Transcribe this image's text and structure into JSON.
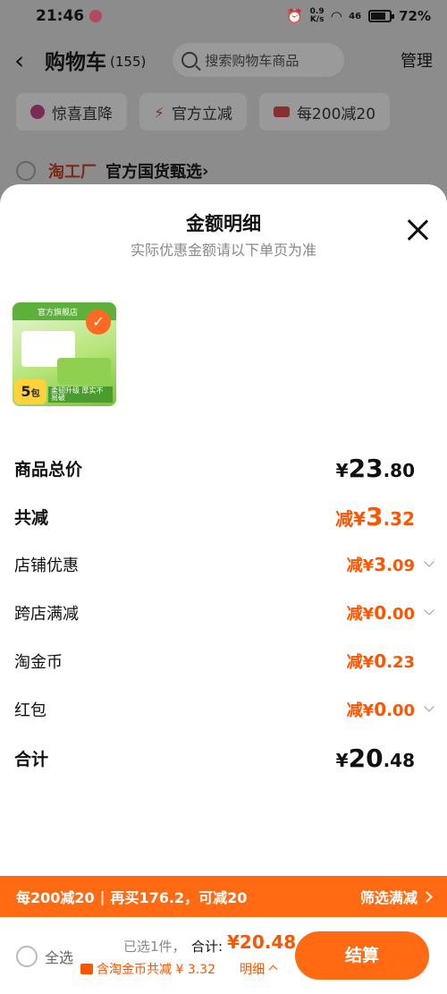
{
  "status_bar": {
    "time": "21:46",
    "net_speed": "0.9",
    "net_unit": "K/s",
    "signal": "46",
    "battery": "72%"
  },
  "header": {
    "title": "购物车",
    "count": "(155)",
    "search_placeholder": "搜索购物车商品",
    "manage": "管理"
  },
  "chips": [
    {
      "label": "惊喜直降"
    },
    {
      "label": "官方立减"
    },
    {
      "label": "每200减20"
    }
  ],
  "shop": {
    "logo": "淘工厂",
    "name": "官方国货甄选",
    "arrow": "›"
  },
  "sheet": {
    "title": "金额明细",
    "subtitle": "实际优惠金额请以下单页为准",
    "product": {
      "band_text": "官方旗舰店",
      "pack_num": "5",
      "pack_unit": "包",
      "strip_text": "柔韧升级 厚实不易破"
    },
    "rows": [
      {
        "label": "商品总价",
        "currency": "¥",
        "int": "23",
        "dec": ".80"
      },
      {
        "label": "共减",
        "prefix": "减¥",
        "int": "3",
        "dec": ".32"
      },
      {
        "label": "店铺优惠",
        "prefix": "减¥",
        "int": "3",
        "dec": ".09"
      },
      {
        "label": "跨店满减",
        "prefix": "减¥",
        "int": "0",
        "dec": ".00"
      },
      {
        "label": "淘金币",
        "prefix": "减¥",
        "int": "0",
        "dec": ".23"
      },
      {
        "label": "红包",
        "prefix": "减¥",
        "int": "0",
        "dec": ".00"
      },
      {
        "label": "合计",
        "currency": "¥",
        "int": "20",
        "dec": ".48"
      }
    ]
  },
  "promo_bar": {
    "left": "每200减20",
    "sep": "|",
    "right": "再买176.2，可减20",
    "filter": "筛选满减"
  },
  "checkout": {
    "select_all": "全选",
    "selected": "已选1件，",
    "total_label": "合计:",
    "total": "¥20.48",
    "coin_text": "含淘金币共减 ¥ 3.32",
    "detail": "明细",
    "pay_button": "结算"
  },
  "colors": {
    "accent": "#ff5500",
    "promo": "#ff6a12",
    "overlay": "#8c8c8c"
  }
}
